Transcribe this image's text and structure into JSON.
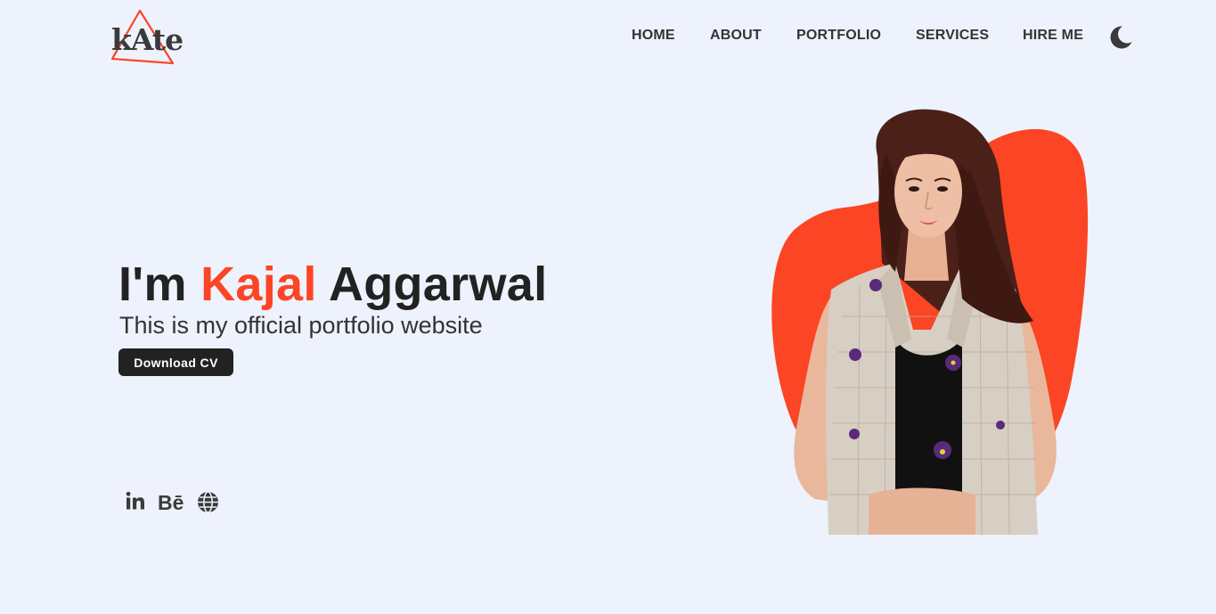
{
  "brand": {
    "logo_text": "kAte",
    "accent_color": "#fc4524",
    "dark_color": "#222222",
    "background_color": "#eef2fc"
  },
  "nav": {
    "items": [
      {
        "label": "HOME"
      },
      {
        "label": "ABOUT"
      },
      {
        "label": "PORTFOLIO"
      },
      {
        "label": "SERVICES"
      },
      {
        "label": "HIRE ME"
      }
    ],
    "theme_toggle_icon": "moon-icon"
  },
  "hero": {
    "greeting": "I'm ",
    "first_name": "Kajal",
    "last_name": " Aggarwal",
    "subtitle": "This is my official portfolio website",
    "cta_label": "Download CV",
    "image_icon": "portrait-photo"
  },
  "socials": [
    {
      "icon": "linkedin-icon",
      "label": "in"
    },
    {
      "icon": "behance-icon",
      "label": "Bē"
    },
    {
      "icon": "globe-icon"
    }
  ]
}
